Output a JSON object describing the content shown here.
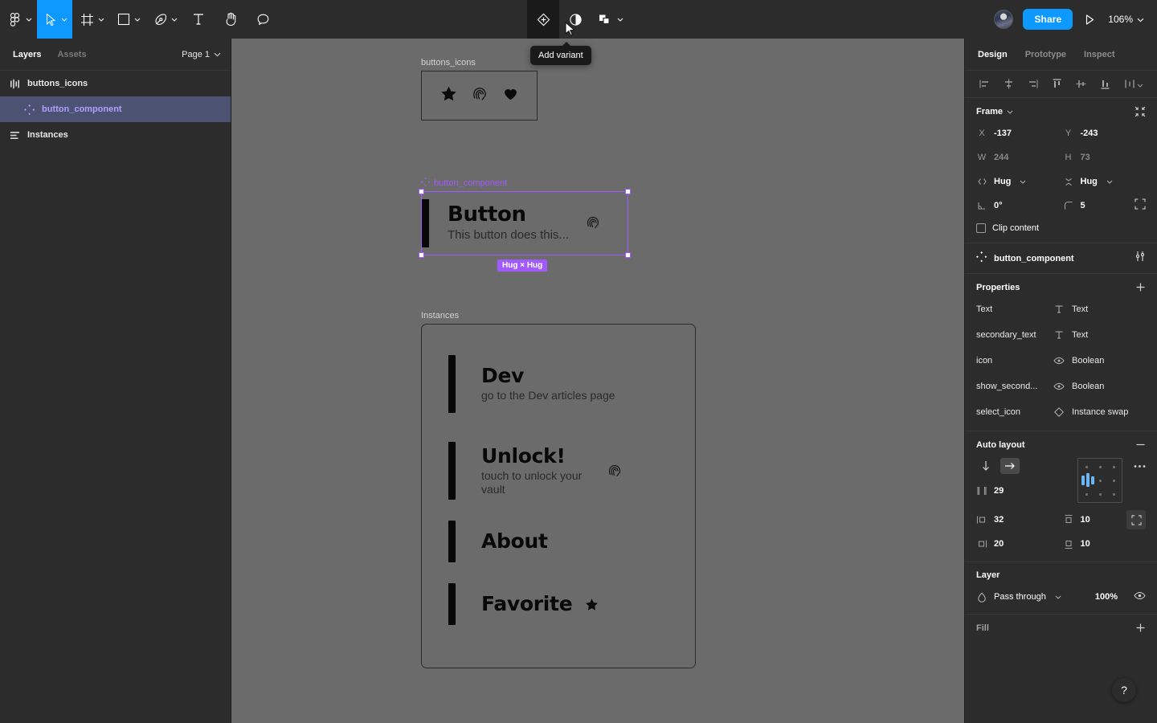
{
  "app": {
    "zoom": "106%"
  },
  "toolbar": {
    "left_tools": [
      {
        "name": "figma-logo-icon",
        "caret": true
      },
      {
        "name": "move-tool-icon",
        "caret": true,
        "active": true
      },
      {
        "name": "frame-tool-icon",
        "caret": true
      },
      {
        "name": "shape-tool-icon",
        "caret": true
      },
      {
        "name": "pen-tool-icon",
        "caret": true
      },
      {
        "name": "text-tool-icon",
        "caret": false
      },
      {
        "name": "hand-tool-icon",
        "caret": false
      },
      {
        "name": "comment-tool-icon",
        "caret": false
      }
    ],
    "center_tools": [
      {
        "name": "add-variant-icon",
        "hovered": true
      },
      {
        "name": "mask-icon",
        "hovered": false
      },
      {
        "name": "boolean-groups-icon",
        "hovered": false,
        "caret": true
      }
    ],
    "tooltip": "Add variant",
    "share_label": "Share",
    "present_label": "present-icon"
  },
  "left_panel": {
    "tabs": [
      {
        "label": "Layers",
        "active": true
      },
      {
        "label": "Assets",
        "active": false
      }
    ],
    "page_selector": "Page 1",
    "layers": [
      {
        "label": "buttons_icons",
        "icon": "variants-icon",
        "selected": false
      },
      {
        "label": "button_component",
        "icon": "component-icon",
        "selected": true
      },
      {
        "label": "Instances",
        "icon": "autolayout-icon",
        "selected": false
      }
    ]
  },
  "canvas": {
    "icons_frame": {
      "label": "buttons_icons",
      "icons": [
        "star-icon",
        "fingerprint-icon",
        "heart-icon"
      ]
    },
    "component": {
      "label": "button_component",
      "title": "Button",
      "subtitle": "This button does this...",
      "trailing_icon": "fingerprint-icon",
      "resize_badge": "Hug × Hug"
    },
    "instances_frame": {
      "label": "Instances",
      "items": [
        {
          "title": "Dev",
          "subtitle": "go to the Dev articles page",
          "trailing_icon": ""
        },
        {
          "title": "Unlock!",
          "subtitle": "touch to unlock your vault",
          "trailing_icon": "fingerprint-icon"
        },
        {
          "title": "About",
          "subtitle": "",
          "trailing_icon": ""
        },
        {
          "title": "Favorite",
          "subtitle": "",
          "trailing_icon": "star-icon"
        }
      ]
    }
  },
  "right_panel": {
    "tabs": [
      {
        "label": "Design",
        "active": true
      },
      {
        "label": "Prototype",
        "active": false
      },
      {
        "label": "Inspect",
        "active": false
      }
    ],
    "align_buttons": [
      "align-left-icon",
      "align-horizontal-center-icon",
      "align-right-icon",
      "align-top-icon",
      "align-vertical-center-icon",
      "align-bottom-icon",
      "distribute-icon"
    ],
    "frame": {
      "title": "Frame",
      "collapse_icon": "collapse-to-fit-icon",
      "x_label": "X",
      "x_value": "-137",
      "y_label": "Y",
      "y_value": "-243",
      "w_label": "W",
      "w_value": "244",
      "h_label": "H",
      "h_value": "73",
      "horizontal_resizing": "Hug",
      "vertical_resizing": "Hug",
      "rotation": "0°",
      "corner_radius": "5",
      "independent_corners_icon": "independent-corners-icon",
      "clip_content_label": "Clip content",
      "clip_content_checked": false
    },
    "component": {
      "name": "button_component",
      "icon": "component-icon",
      "settings_icon": "tune-sliders-icon"
    },
    "properties": {
      "title": "Properties",
      "add_icon": "plus-icon",
      "items": [
        {
          "name": "Text",
          "type": "Text",
          "type_icon": "text-property-icon"
        },
        {
          "name": "secondary_text",
          "type": "Text",
          "type_icon": "text-property-icon"
        },
        {
          "name": "icon",
          "type": "Boolean",
          "type_icon": "boolean-property-icon"
        },
        {
          "name": "show_second...",
          "type": "Boolean",
          "type_icon": "boolean-property-icon"
        },
        {
          "name": "select_icon",
          "type": "Instance swap",
          "type_icon": "instance-swap-icon"
        }
      ]
    },
    "auto_layout": {
      "title": "Auto layout",
      "remove_icon": "minus-icon",
      "more_icon": "more-options-icon",
      "direction_vertical_icon": "arrow-down-icon",
      "direction_horizontal_icon": "arrow-right-icon",
      "direction_active": "horizontal",
      "gap_label": "gap-between-icon",
      "gap": "29",
      "padding_left_icon": "padding-horizontal-icon",
      "padding_horizontal": "32",
      "padding_top_icon": "padding-top-icon",
      "padding_top": "10",
      "padding_right_icon": "padding-right-icon",
      "padding_vertical": "20",
      "padding_bottom_icon": "padding-bottom-icon",
      "padding_bottom": "10",
      "advanced_icon": "advanced-layout-icon"
    },
    "layer": {
      "title": "Layer",
      "blend_icon": "blend-mode-icon",
      "blend_mode": "Pass through",
      "opacity": "100%",
      "visibility_icon": "eye-icon"
    },
    "fill": {
      "title": "Fill",
      "add_icon": "plus-icon"
    }
  },
  "help": {
    "label": "?"
  },
  "colors": {
    "accent_blue": "#0d99ff",
    "component_purple": "#a259ff",
    "panel_bg": "#2c2c2c",
    "canvas_bg": "#6b6b6b",
    "selected_layer_bg": "#4c5372"
  }
}
